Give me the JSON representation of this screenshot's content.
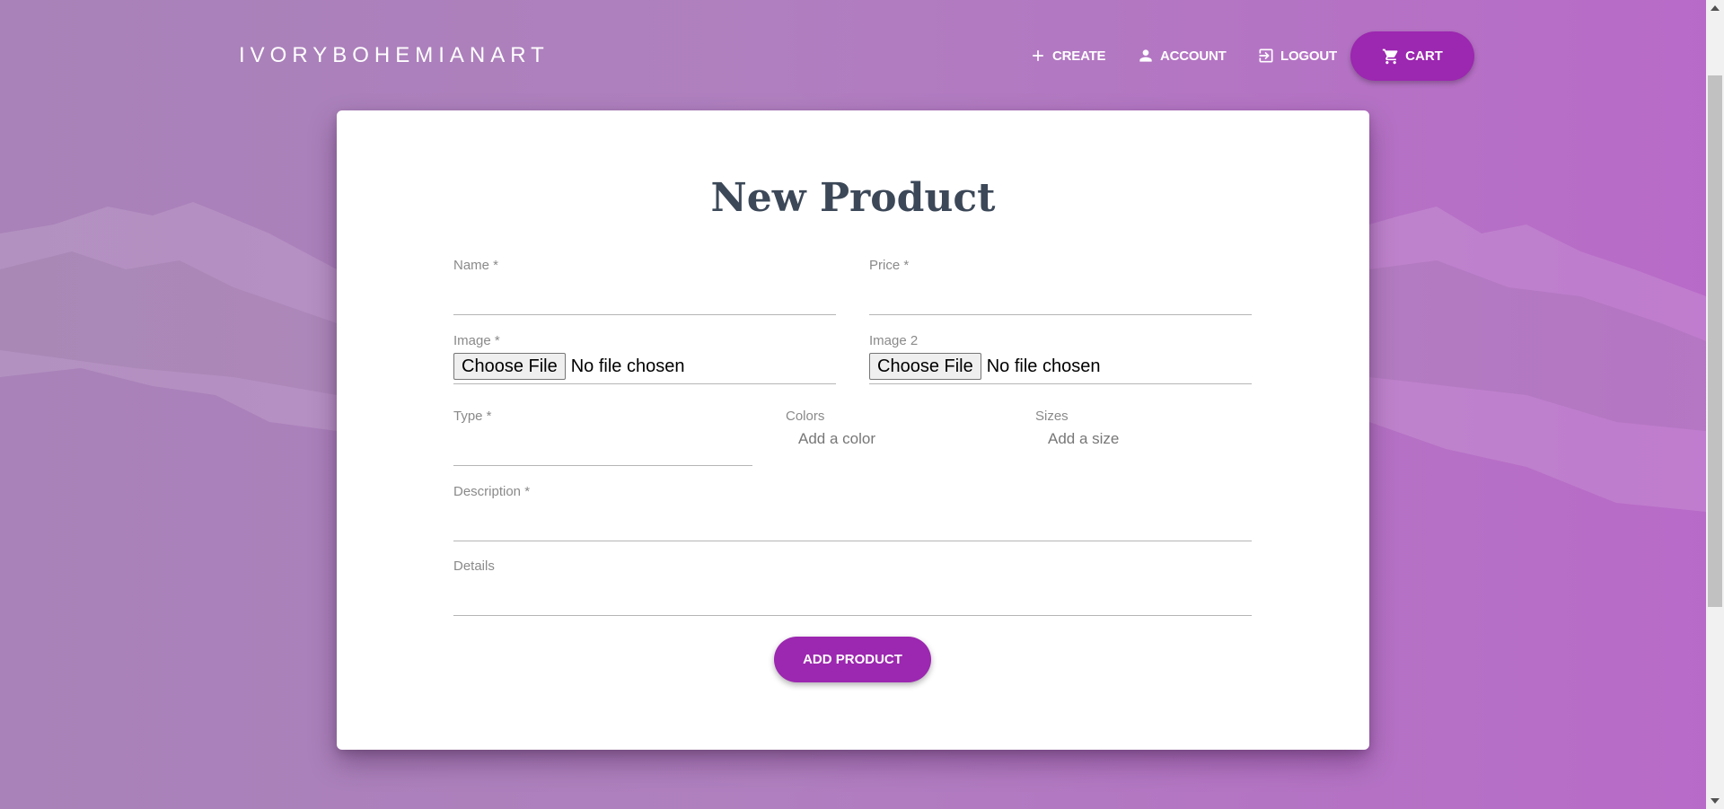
{
  "nav": {
    "brand": "IVORYBOHEMIANART",
    "create_label": "CREATE",
    "account_label": "ACCOUNT",
    "logout_label": "LOGOUT",
    "cart_label": "CART"
  },
  "form": {
    "title": "New Product",
    "name_label": "Name *",
    "price_label": "Price *",
    "image_label": "Image *",
    "image2_label": "Image 2",
    "file_button_label": "Choose File",
    "file_status": "No file chosen",
    "type_label": "Type *",
    "colors_label": "Colors",
    "colors_placeholder": "Add a color",
    "sizes_label": "Sizes",
    "sizes_placeholder": "Add a size",
    "description_label": "Description *",
    "details_label": "Details",
    "submit_label": "ADD PRODUCT"
  },
  "theme": {
    "accent": "#9c27b0",
    "title_color": "#3c4858"
  }
}
